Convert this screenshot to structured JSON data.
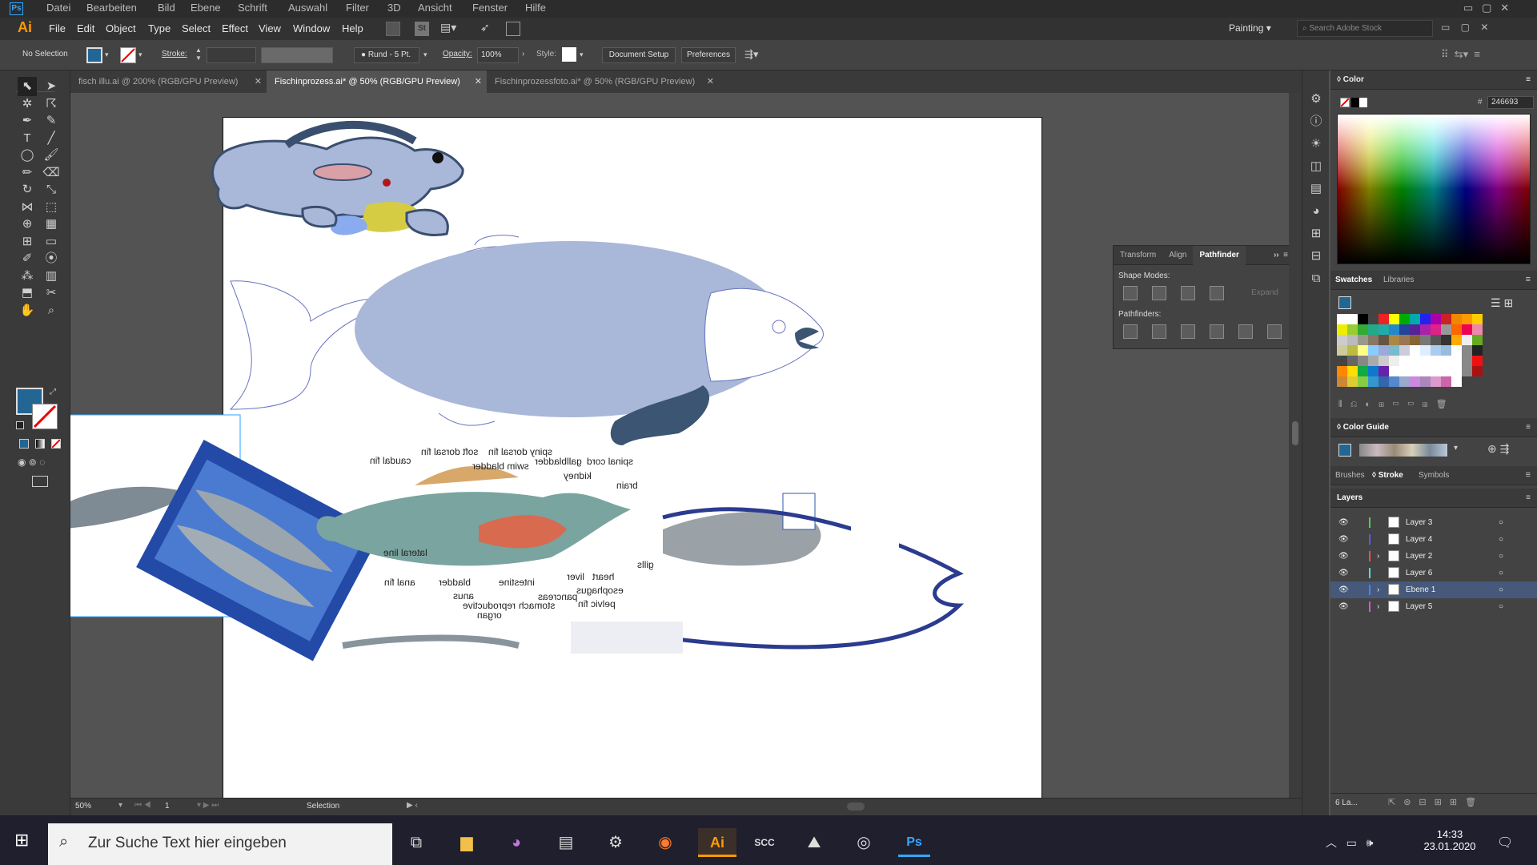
{
  "ps_menu": [
    "Datei",
    "Bearbeiten",
    "Bild",
    "Ebene",
    "Schrift",
    "Auswahl",
    "Filter",
    "3D",
    "Ansicht",
    "Fenster",
    "Hilfe"
  ],
  "ai_menu": [
    "File",
    "Edit",
    "Object",
    "Type",
    "Select",
    "Effect",
    "View",
    "Window",
    "Help"
  ],
  "workspace": "Painting",
  "stock_search_placeholder": "Search Adobe Stock",
  "control": {
    "selection": "No Selection",
    "stroke_label": "Stroke:",
    "brush": "Rund - 5 Pt.",
    "opacity_label": "Opacity:",
    "opacity_value": "100%",
    "style_label": "Style:",
    "doc_setup": "Document Setup",
    "preferences": "Preferences"
  },
  "tabs": [
    {
      "label": "fisch illu.ai @ 200% (RGB/GPU Preview)",
      "active": false
    },
    {
      "label": "Fischinprozess.ai* @ 50% (RGB/GPU Preview)",
      "active": true
    },
    {
      "label": "Fischinprozessfoto.ai* @ 50% (RGB/GPU Preview)",
      "active": false
    }
  ],
  "fish_labels": {
    "caudal_fin": "caudal fin",
    "soft_dorsal_fin": "soft dorsal fin",
    "spiny_dorsal_fin": "spiny dorsal fin",
    "spinal_cord": "spinal cord",
    "swim_bladder": "swim bladder",
    "gallbladder": "gallbladder",
    "kidney": "kidney",
    "brain": "brain",
    "lateral_line": "lateral line",
    "gills": "gills",
    "anal_fin": "anal fin",
    "bladder": "bladder",
    "intestine": "intestine",
    "liver": "liver",
    "heart": "heart",
    "esophagus": "esophagus",
    "anus": "anus",
    "reproductive": "reproductive",
    "organ": "organ",
    "stomach": "stomach",
    "pancreas": "pancreas",
    "pelvic_fin": "pelvic fin"
  },
  "status": {
    "zoom": "50%",
    "page": "1",
    "tool": "Selection"
  },
  "pathfinder": {
    "tabs": [
      "Transform",
      "Align",
      "Pathfinder"
    ],
    "shape_modes": "Shape Modes:",
    "pathfinders": "Pathfinders:",
    "expand": "Expand"
  },
  "color_panel": {
    "title": "Color",
    "hex": "246693"
  },
  "swatches_tabs": [
    "Swatches",
    "Libraries"
  ],
  "color_guide": "Color Guide",
  "brush_tabs": [
    "Brushes",
    "Stroke",
    "Symbols"
  ],
  "layers_title": "Layers",
  "layers": [
    {
      "name": "Layer 3",
      "color": "#4fcf4f",
      "expand": false,
      "selected": false
    },
    {
      "name": "Layer 4",
      "color": "#5a5aff",
      "expand": false,
      "selected": false
    },
    {
      "name": "Layer 2",
      "color": "#ff4f4f",
      "expand": true,
      "selected": false
    },
    {
      "name": "Layer 6",
      "color": "#4fdfdf",
      "expand": false,
      "selected": false
    },
    {
      "name": "Ebene 1",
      "color": "#4f7fff",
      "expand": true,
      "selected": true
    },
    {
      "name": "Layer 5",
      "color": "#df4fdf",
      "expand": true,
      "selected": false
    }
  ],
  "layers_count": "6 La...",
  "taskbar": {
    "search": "Zur Suche Text hier eingeben",
    "time": "14:33",
    "date": "23.01.2020"
  },
  "colors": {
    "fill": "#246693",
    "fish_body": "#a9b7d8",
    "dark_fish": "#3b5573",
    "accent_outline": "#2b3b8f"
  }
}
